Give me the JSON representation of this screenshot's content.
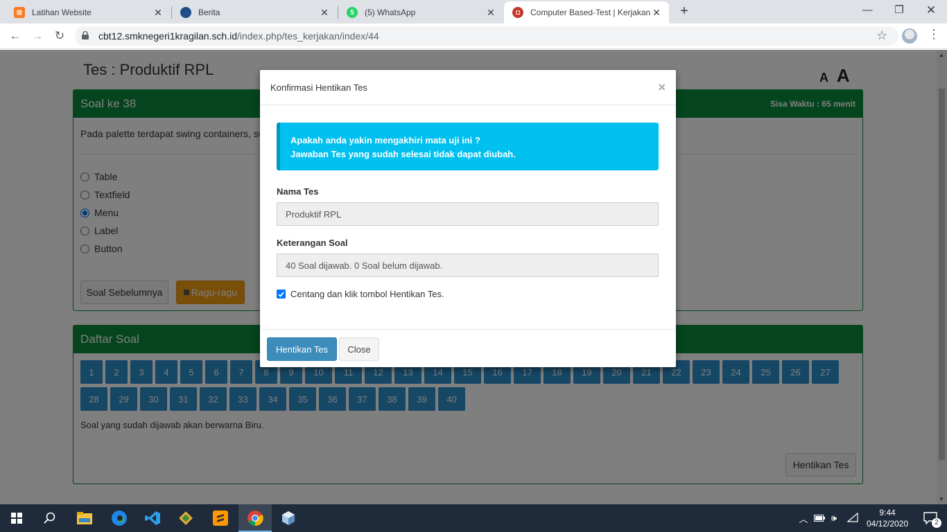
{
  "browser": {
    "tabs": [
      {
        "title": "Latihan Website",
        "icon": "xampp-icon",
        "color": "#fb7a24"
      },
      {
        "title": "Berita",
        "icon": "edu-logo-icon",
        "color": "#1d4e89"
      },
      {
        "title": "(5) WhatsApp",
        "icon": "whatsapp-icon",
        "color": "#25d366",
        "badge": "5"
      },
      {
        "title": "Computer Based-Test | Kerjakan T",
        "icon": "cbt-icon",
        "color": "#c0392b"
      }
    ],
    "url_host": "cbt12.smknegeri1kragilan.sch.id",
    "url_path": "/index.php/tes_kerjakan/index/44"
  },
  "page": {
    "test_title": "Tes : Produktif RPL",
    "font_small": "A",
    "font_large": "A",
    "question_panel": {
      "title": "Soal ke 38",
      "timer": "Sisa Waktu : 65 menit",
      "question": "Pada palette terdapat swing containers, sw",
      "options": [
        {
          "label": "Table",
          "selected": false
        },
        {
          "label": "Textfield",
          "selected": false
        },
        {
          "label": "Menu",
          "selected": true
        },
        {
          "label": "Label",
          "selected": false
        },
        {
          "label": "Button",
          "selected": false
        }
      ],
      "prev_button": "Soal Sebelumnya",
      "doubt_button": "Ragu-ragu"
    },
    "list_panel": {
      "title": "Daftar Soal",
      "numbers": [
        "1",
        "2",
        "3",
        "4",
        "5",
        "6",
        "7",
        "8",
        "9",
        "10",
        "11",
        "12",
        "13",
        "14",
        "15",
        "16",
        "17",
        "18",
        "19",
        "20",
        "21",
        "22",
        "23",
        "24",
        "25",
        "26",
        "27",
        "28",
        "29",
        "30",
        "31",
        "32",
        "33",
        "34",
        "35",
        "36",
        "37",
        "38",
        "39",
        "40"
      ],
      "note": "Soal yang sudah dijawab akan berwarna Biru.",
      "stop_button": "Hentikan Tes"
    }
  },
  "modal": {
    "title": "Konfirmasi Hentikan Tes",
    "close_glyph": "×",
    "alert_line1": "Apakah anda yakin mengakhiri mata uji ini ?",
    "alert_line2": "Jawaban Tes yang sudah selesai tidak dapat diubah.",
    "name_label": "Nama Tes",
    "name_value": "Produktif RPL",
    "desc_label": "Keterangan Soal",
    "desc_value": "40 Soal dijawab. 0 Soal belum dijawab.",
    "checkbox_label": "Centang dan klik tombol Hentikan Tes.",
    "checkbox_checked": true,
    "confirm_button": "Hentikan Tes",
    "close_button": "Close"
  },
  "taskbar": {
    "time": "9:44",
    "date": "04/12/2020",
    "notification_count": "2"
  }
}
